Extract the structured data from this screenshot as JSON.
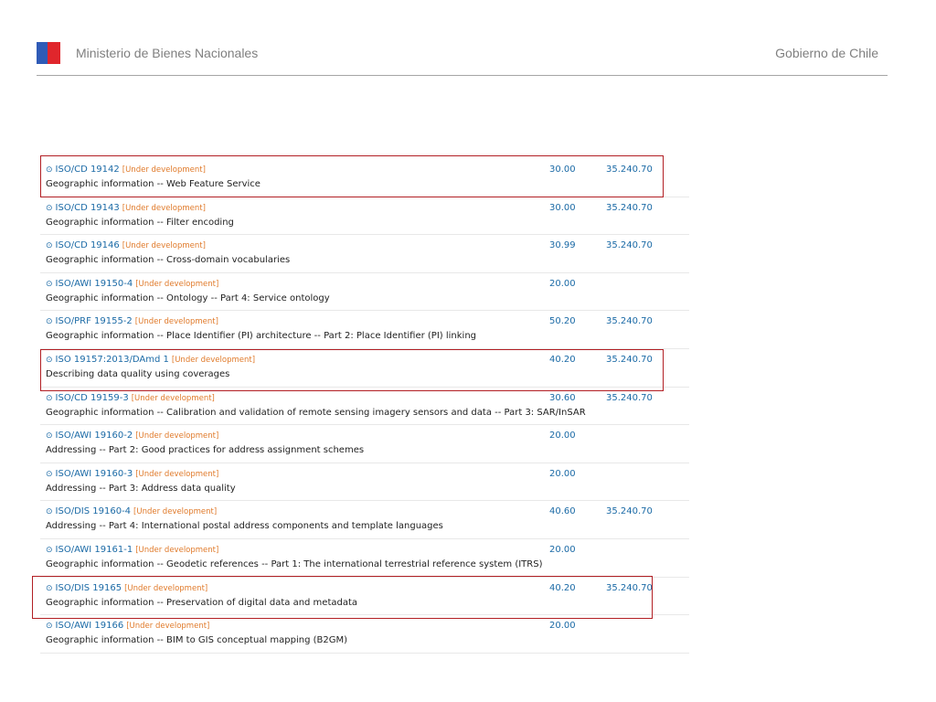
{
  "header": {
    "ministry": "Ministerio de Bienes Nacionales",
    "government": "Gobierno de Chile",
    "flag_colors": {
      "blue": "#2f5bb7",
      "red": "#e0262c"
    }
  },
  "colors": {
    "link": "#1b6aa6",
    "status": "#e07a2a",
    "highlight": "#b21f24"
  },
  "standards": [
    {
      "code": "ISO/CD 19142",
      "status": "[Under development]",
      "title": "Geographic information -- Web Feature Service",
      "stage": "30.00",
      "ics": "35.240.70"
    },
    {
      "code": "ISO/CD 19143",
      "status": "[Under development]",
      "title": "Geographic information -- Filter encoding",
      "stage": "30.00",
      "ics": "35.240.70"
    },
    {
      "code": "ISO/CD 19146",
      "status": "[Under development]",
      "title": "Geographic information -- Cross-domain vocabularies",
      "stage": "30.99",
      "ics": "35.240.70"
    },
    {
      "code": "ISO/AWI 19150-4",
      "status": "[Under development]",
      "title": "Geographic information -- Ontology -- Part 4: Service ontology",
      "stage": "20.00",
      "ics": ""
    },
    {
      "code": "ISO/PRF 19155-2",
      "status": "[Under development]",
      "title": "Geographic information -- Place Identifier (PI) architecture -- Part 2: Place Identifier (PI) linking",
      "stage": "50.20",
      "ics": "35.240.70"
    },
    {
      "code": "ISO 19157:2013/DAmd 1",
      "status": "[Under development]",
      "title": "Describing data quality using coverages",
      "stage": "40.20",
      "ics": "35.240.70"
    },
    {
      "code": "ISO/CD 19159-3",
      "status": "[Under development]",
      "title": "Geographic information -- Calibration and validation of remote sensing imagery sensors and data -- Part 3: SAR/InSAR",
      "stage": "30.60",
      "ics": "35.240.70"
    },
    {
      "code": "ISO/AWI 19160-2",
      "status": "[Under development]",
      "title": "Addressing -- Part 2: Good practices for address assignment schemes",
      "stage": "20.00",
      "ics": ""
    },
    {
      "code": "ISO/AWI 19160-3",
      "status": "[Under development]",
      "title": "Addressing -- Part 3: Address data quality",
      "stage": "20.00",
      "ics": ""
    },
    {
      "code": "ISO/DIS 19160-4",
      "status": "[Under development]",
      "title": "Addressing -- Part 4: International postal address components and template languages",
      "stage": "40.60",
      "ics": "35.240.70"
    },
    {
      "code": "ISO/AWI 19161-1",
      "status": "[Under development]",
      "title": "Geographic information -- Geodetic references -- Part 1: The international terrestrial reference system (ITRS)",
      "stage": "20.00",
      "ics": ""
    },
    {
      "code": "ISO/DIS 19165",
      "status": "[Under development]",
      "title": "Geographic information -- Preservation of digital data and metadata",
      "stage": "40.20",
      "ics": "35.240.70"
    },
    {
      "code": "ISO/AWI 19166",
      "status": "[Under development]",
      "title": "Geographic information -- BIM to GIS conceptual mapping (B2GM)",
      "stage": "20.00",
      "ics": ""
    }
  ]
}
